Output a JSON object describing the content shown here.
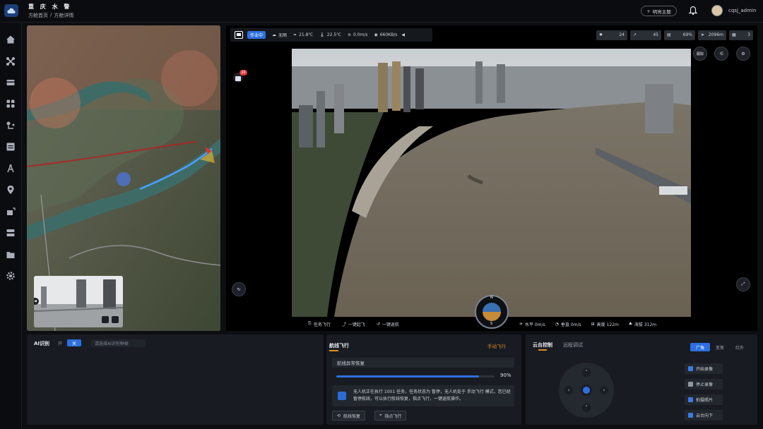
{
  "header": {
    "title": "重 庆 水 警",
    "breadcrumb": [
      "方舱首页",
      "/",
      "方舱详情"
    ],
    "theme_label": "明亮主题",
    "username": "cqsj_admin"
  },
  "sidebar": {
    "icons": [
      "home-icon",
      "drone-icon",
      "dock-icon",
      "apps-icon",
      "route-icon",
      "media-icon",
      "tower-icon",
      "location-icon",
      "device-icon",
      "server-icon",
      "folder-icon",
      "settings-icon"
    ]
  },
  "map": {
    "pip_lens_label": "◀"
  },
  "status_bar": {
    "mode": "作业中",
    "weather": "无雨",
    "humidity": "21.8℃",
    "temperature": "22.5℃",
    "wind": "0.0m/s",
    "network": "660KB/s"
  },
  "telemetry_top": {
    "satellites": "24",
    "signal": "45",
    "battery": "69%",
    "distance": "2096m",
    "count": "3"
  },
  "video": {
    "follow_label": "跟踪",
    "recording_badge": "20"
  },
  "flight_bar": {
    "task_flight": "任务飞行",
    "one_key_takeoff": "一键起飞",
    "one_key_return": "一键返航",
    "horizontal_speed": "水平 0m/s",
    "vertical_speed": "垂直 0m/s",
    "height": "高度 122m",
    "altitude": "海拔 312m"
  },
  "ai_panel": {
    "title": "AI识别",
    "toggle_on": "开",
    "toggle_off": "关",
    "select_placeholder": "请选择AI识别种类"
  },
  "route_panel": {
    "title": "航线飞行",
    "manual_link": "手动飞行",
    "resume_label": "航线异常恢复",
    "progress_pct": "90%",
    "progress_value": 0.9,
    "info_text": "无人机正在执行 1001 任务，任务状态为 暂停，无人机处于 手动飞行 模式，您已经暂停航线，可以执行航线恢复，指点飞行，一键返航操作。",
    "resume_button": "航线恢复",
    "point_button": "指点飞行"
  },
  "gimbal_panel": {
    "tab_control": "云台控制",
    "tab_debug": "远程调试",
    "lenses": [
      "广角",
      "变焦",
      "红外"
    ],
    "actions": [
      "开始录像",
      "停止录像",
      "拍摄照片",
      "云台向下"
    ]
  },
  "compass": {
    "north": "N",
    "south": "S"
  }
}
